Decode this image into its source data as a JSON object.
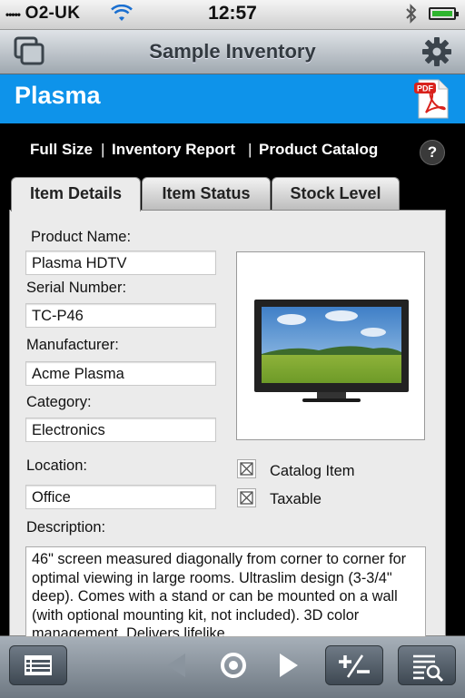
{
  "status_bar": {
    "carrier": "O2-UK",
    "time": "12:57",
    "signal_glyph": "•••••"
  },
  "nav": {
    "title": "Sample Inventory",
    "left_icon": "windows-icon",
    "right_icon": "gear-icon"
  },
  "record": {
    "name": "Plasma",
    "pdf_icon": "pdf-icon",
    "pdf_badge": "PDF"
  },
  "links": [
    "Full Size",
    "Inventory Report",
    "Product Catalog"
  ],
  "help_label": "?",
  "tabs": [
    "Item Details",
    "Item Status",
    "Stock Level"
  ],
  "form": {
    "product_name_label": "Product Name:",
    "product_name": "Plasma HDTV",
    "serial_label": "Serial Number:",
    "serial": "TC-P46",
    "manufacturer_label": "Manufacturer:",
    "manufacturer": "Acme Plasma",
    "category_label": "Category:",
    "category": "Electronics",
    "location_label": "Location:",
    "location": "Office",
    "catalog_item_label": "Catalog Item",
    "catalog_item_checked": true,
    "taxable_label": "Taxable",
    "taxable_checked": true,
    "description_label": "Description:",
    "description": "46\" screen measured diagonally from corner to corner for optimal viewing in large rooms.  Ultraslim design (3-3/4\" deep).  Comes with a stand or can be mounted on a wall (with optional mounting kit, not included).  3D color management.  Delivers lifelike"
  },
  "toolbar": {
    "items": [
      "list-icon",
      "previous-icon",
      "record-icon",
      "next-icon",
      "plus-minus-icon",
      "search-list-icon"
    ]
  },
  "colors": {
    "header": "#0e93ea",
    "panel": "#ebebeb"
  }
}
